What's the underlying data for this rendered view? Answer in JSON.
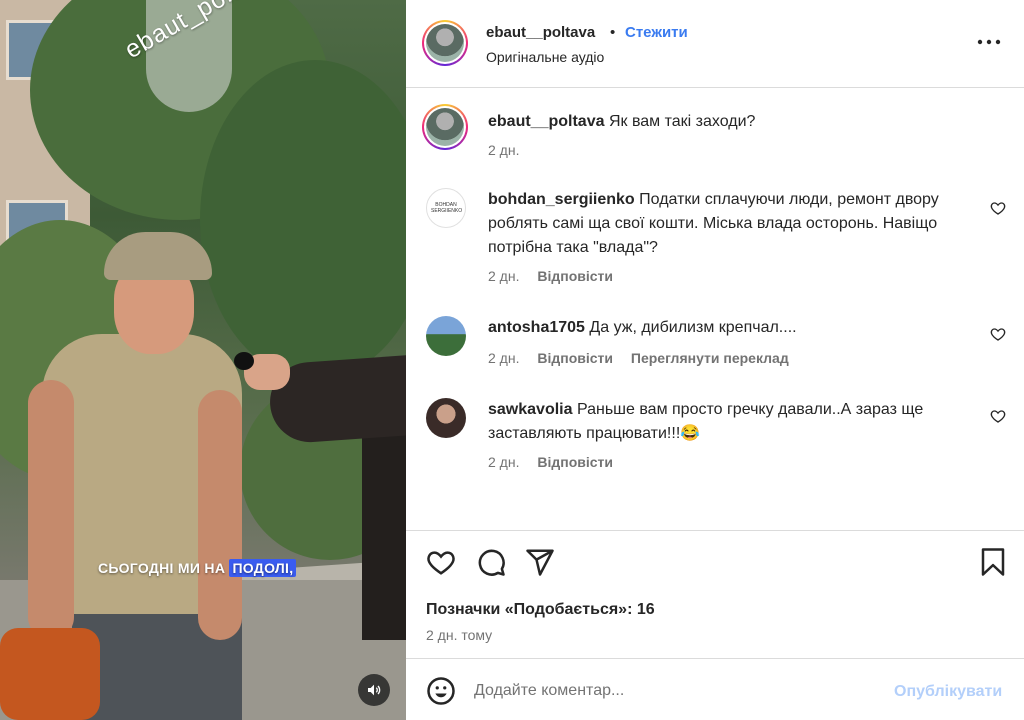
{
  "media": {
    "watermark": "ebaut_poltava",
    "subtitle_plain": "СЬОГОДНІ МИ НА ",
    "subtitle_highlight": "ПОДОЛІ,"
  },
  "header": {
    "username": "ebaut__poltava",
    "separator": "•",
    "follow_label": "Стежити",
    "audio_label": "Оригінальне аудіо"
  },
  "caption": {
    "username": "ebaut__poltava",
    "text": "Як вам такі заходи?",
    "time": "2 дн."
  },
  "comments": [
    {
      "username": "bohdan_sergiienko",
      "avatar_text": "BOHDAN SERGIIENKO",
      "text": "Податки сплачуючи люди, ремонт двору роблять самі ща свої кошти. Міська влада осторонь. Навіщо потрібна така \"влада\"?",
      "time": "2 дн.",
      "reply": "Відповісти"
    },
    {
      "username": "antosha1705",
      "text": "Да уж, дибилизм крепчал....",
      "time": "2 дн.",
      "reply": "Відповісти",
      "translate": "Переглянути переклад"
    },
    {
      "username": "sawkavolia",
      "text": "Раньше вам просто гречку давали..А зараз ще заставляють працювати!!!😂",
      "time": "2 дн.",
      "reply": "Відповісти"
    }
  ],
  "likes_text": "Позначки «Подобається»: 16",
  "posted_time": "2 дн. тому",
  "composer": {
    "placeholder": "Додайте коментар...",
    "post_label": "Опублікувати"
  },
  "colors": {
    "accent": "#3a7bf0",
    "post_disabled": "#b3cffa",
    "subtitle_highlight": "#3a5cf0"
  },
  "icons": [
    "more-options-icon",
    "heart-icon",
    "comment-icon",
    "share-icon",
    "bookmark-icon",
    "emoji-icon",
    "sound-icon"
  ]
}
